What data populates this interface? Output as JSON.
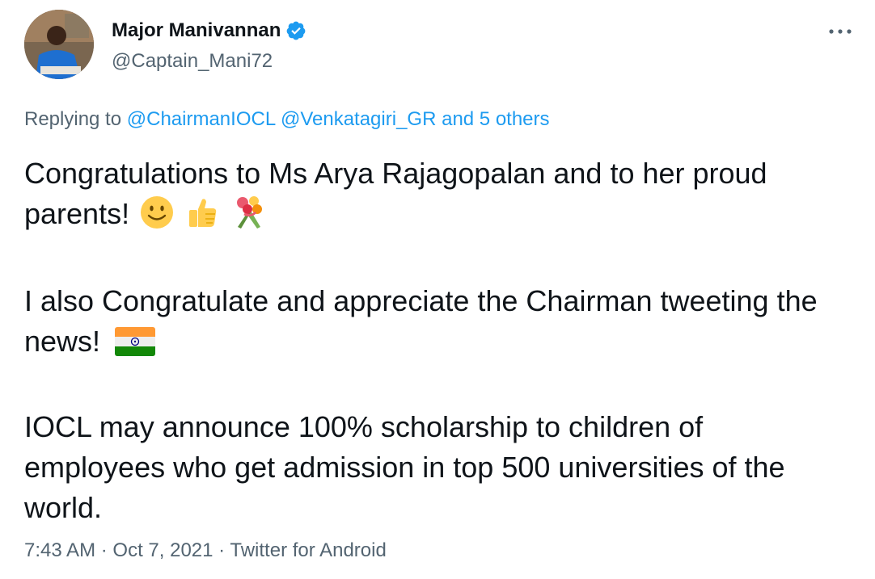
{
  "author": {
    "display_name": "Major Manivannan",
    "handle": "@Captain_Mani72",
    "verified": true
  },
  "reply_context": {
    "prefix": "Replying to",
    "mentions": [
      "@ChairmanIOCL",
      "@Venkatagiri_GR"
    ],
    "others": "and 5 others"
  },
  "tweet": {
    "para1": "Congratulations to Ms Arya Rajagopalan and to her proud parents!",
    "para2": "I also Congratulate and appreciate the Chairman tweeting the news!",
    "para3": "IOCL may announce 100% scholarship to children of employees who get admission in top 500 universities of the world."
  },
  "meta": {
    "time": "7:43 AM",
    "date": "Oct 7, 2021",
    "source": "Twitter for Android",
    "separator": "·"
  },
  "icons": [
    "avatar-photo",
    "verified-badge-icon",
    "more-options-icon",
    "smiley-face-icon",
    "thumbs-up-icon",
    "bouquet-icon",
    "india-flag-icon"
  ],
  "colors": {
    "link": "#1d9bf0",
    "secondary_text": "#536471",
    "primary_text": "#0f1419"
  }
}
